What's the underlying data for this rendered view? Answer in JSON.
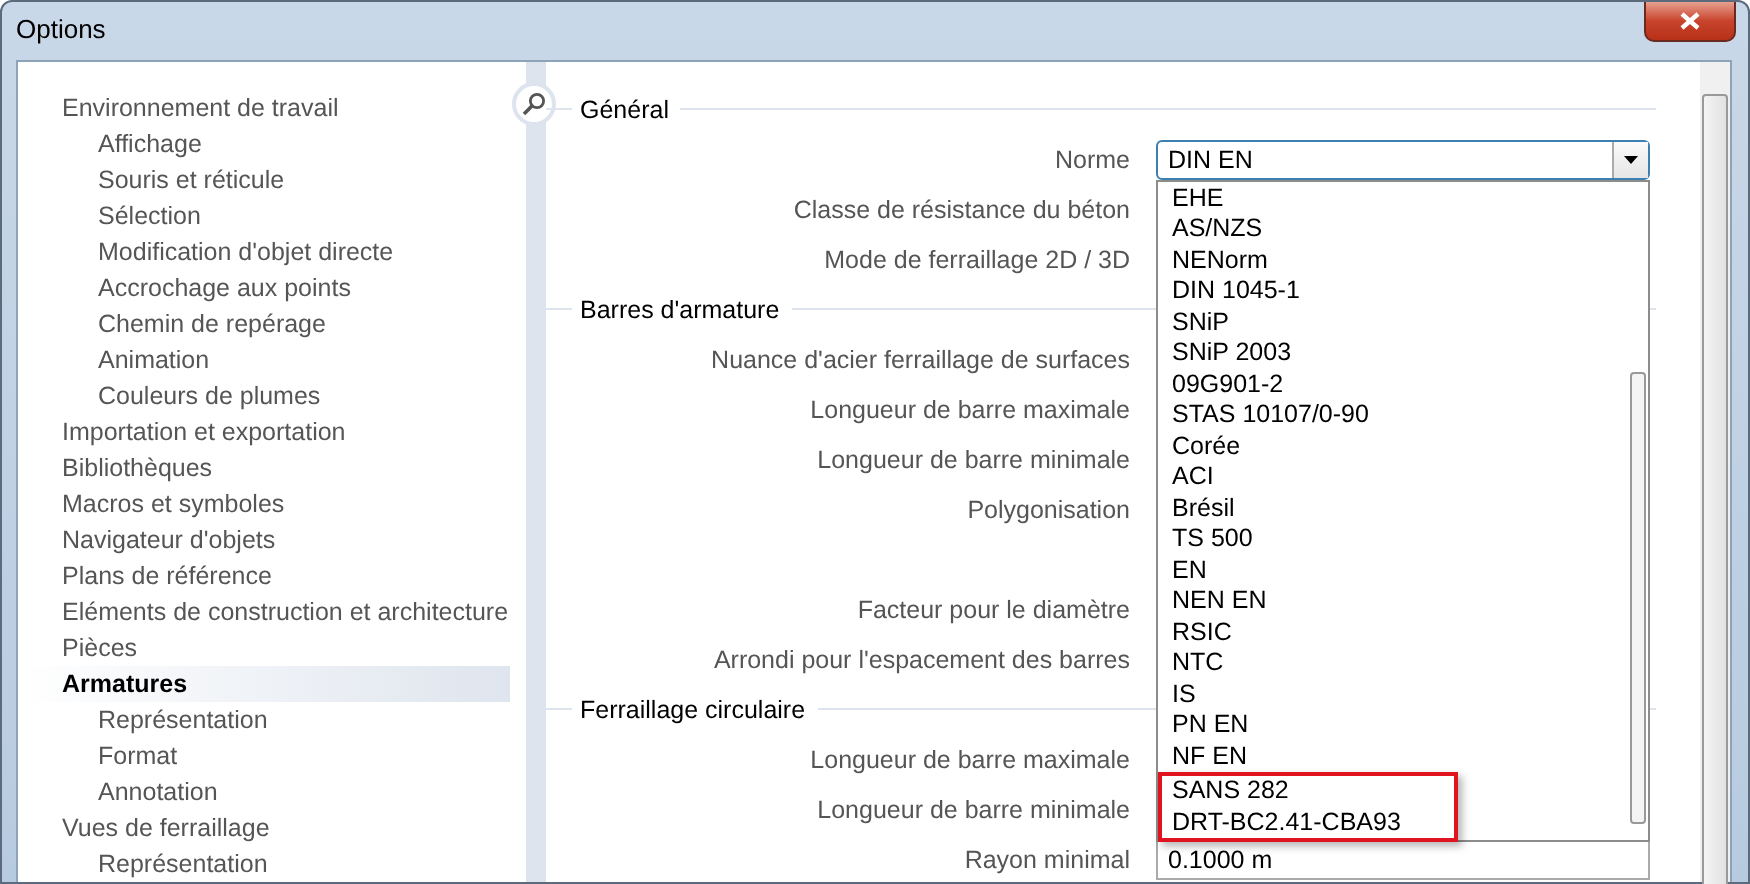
{
  "window": {
    "title": "Options"
  },
  "sidebar": {
    "items": [
      {
        "label": "Environnement de travail",
        "selected": false,
        "children": [
          {
            "label": "Affichage",
            "selected": false
          },
          {
            "label": "Souris et réticule",
            "selected": false
          },
          {
            "label": "Sélection",
            "selected": false
          },
          {
            "label": "Modification d'objet directe",
            "selected": false
          },
          {
            "label": "Accrochage aux points",
            "selected": false
          },
          {
            "label": "Chemin de repérage",
            "selected": false
          },
          {
            "label": "Animation",
            "selected": false
          },
          {
            "label": "Couleurs de plumes",
            "selected": false
          }
        ]
      },
      {
        "label": "Importation et exportation",
        "selected": false
      },
      {
        "label": "Bibliothèques",
        "selected": false
      },
      {
        "label": "Macros et symboles",
        "selected": false
      },
      {
        "label": "Navigateur d'objets",
        "selected": false
      },
      {
        "label": "Plans de référence",
        "selected": false
      },
      {
        "label": "Eléments de construction et architecture",
        "selected": false
      },
      {
        "label": "Pièces",
        "selected": false
      },
      {
        "label": "Armatures",
        "selected": true,
        "children": [
          {
            "label": "Représentation",
            "selected": false
          },
          {
            "label": "Format",
            "selected": false
          },
          {
            "label": "Annotation",
            "selected": false
          }
        ]
      },
      {
        "label": "Vues de ferraillage",
        "selected": false,
        "children": [
          {
            "label": "Représentation",
            "selected": false
          }
        ]
      }
    ]
  },
  "sections": [
    {
      "title": "Général",
      "rows": [
        {
          "kind": "field",
          "label": "Norme",
          "dropdown": {
            "value": "DIN EN",
            "expanded": true,
            "options": [
              {
                "label": "EHE",
                "marked": false
              },
              {
                "label": "AS/NZS",
                "marked": false
              },
              {
                "label": "NENorm",
                "marked": false
              },
              {
                "label": "DIN 1045-1",
                "marked": false
              },
              {
                "label": "SNiP",
                "marked": false
              },
              {
                "label": "SNiP 2003",
                "marked": false
              },
              {
                "label": "09G901-2",
                "marked": false
              },
              {
                "label": "STAS 10107/0-90",
                "marked": false
              },
              {
                "label": "Corée",
                "marked": false
              },
              {
                "label": "ACI",
                "marked": false
              },
              {
                "label": "Brésil",
                "marked": false
              },
              {
                "label": "TS 500",
                "marked": false
              },
              {
                "label": "EN",
                "marked": false
              },
              {
                "label": "NEN EN",
                "marked": false
              },
              {
                "label": "RSIC",
                "marked": false
              },
              {
                "label": "NTC",
                "marked": false
              },
              {
                "label": "IS",
                "marked": false
              },
              {
                "label": "PN EN",
                "marked": false
              },
              {
                "label": "NF EN",
                "marked": false
              },
              {
                "label": "SANS 282",
                "marked": true
              },
              {
                "label": "DRT-BC2.41-CBA93",
                "marked": true
              }
            ]
          }
        },
        {
          "kind": "field",
          "label": "Classe de résistance du béton"
        },
        {
          "kind": "field",
          "label": "Mode de ferraillage 2D / 3D"
        }
      ]
    },
    {
      "title": "Barres d'armature",
      "rows": [
        {
          "kind": "field",
          "label": "Nuance d'acier ferraillage de surfaces"
        },
        {
          "kind": "field",
          "label": "Longueur de barre maximale"
        },
        {
          "kind": "field",
          "label": "Longueur de barre minimale"
        },
        {
          "kind": "field",
          "label": "Polygonisation"
        },
        {
          "kind": "blank"
        },
        {
          "kind": "field",
          "label": "Facteur pour le diamètre"
        },
        {
          "kind": "field",
          "label": "Arrondi pour l'espacement des barres"
        }
      ]
    },
    {
      "title": "Ferraillage circulaire",
      "rows": [
        {
          "kind": "field",
          "label": "Longueur de barre maximale"
        },
        {
          "kind": "field",
          "label": "Longueur de barre minimale"
        },
        {
          "kind": "field",
          "label": "Rayon minimal",
          "value": "0.1000 m"
        }
      ]
    }
  ]
}
